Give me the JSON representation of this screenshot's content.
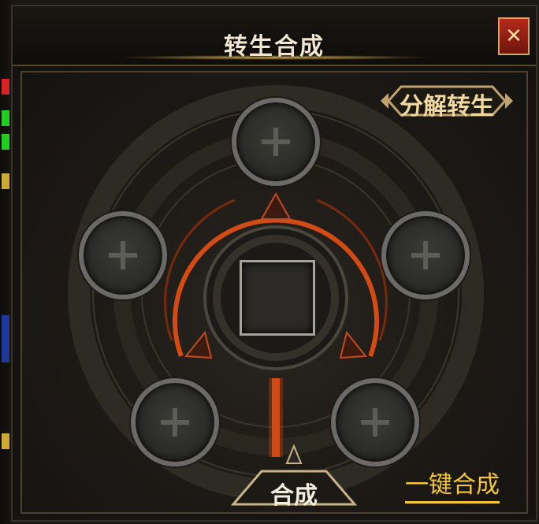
{
  "window": {
    "title": "转生合成",
    "close_label": "✕"
  },
  "buttons": {
    "split_rebirth": "分解转生",
    "merge": "合成",
    "one_key_merge": "一键合成"
  },
  "slots": {
    "material_slot_count": 5,
    "result_slot_empty": true
  },
  "icons": {
    "close": "close-icon",
    "add": "plus-icon"
  },
  "colors": {
    "accent_gold": "#f6c934",
    "close_red": "#b42a1a",
    "ring_orange": "#d24a14"
  }
}
